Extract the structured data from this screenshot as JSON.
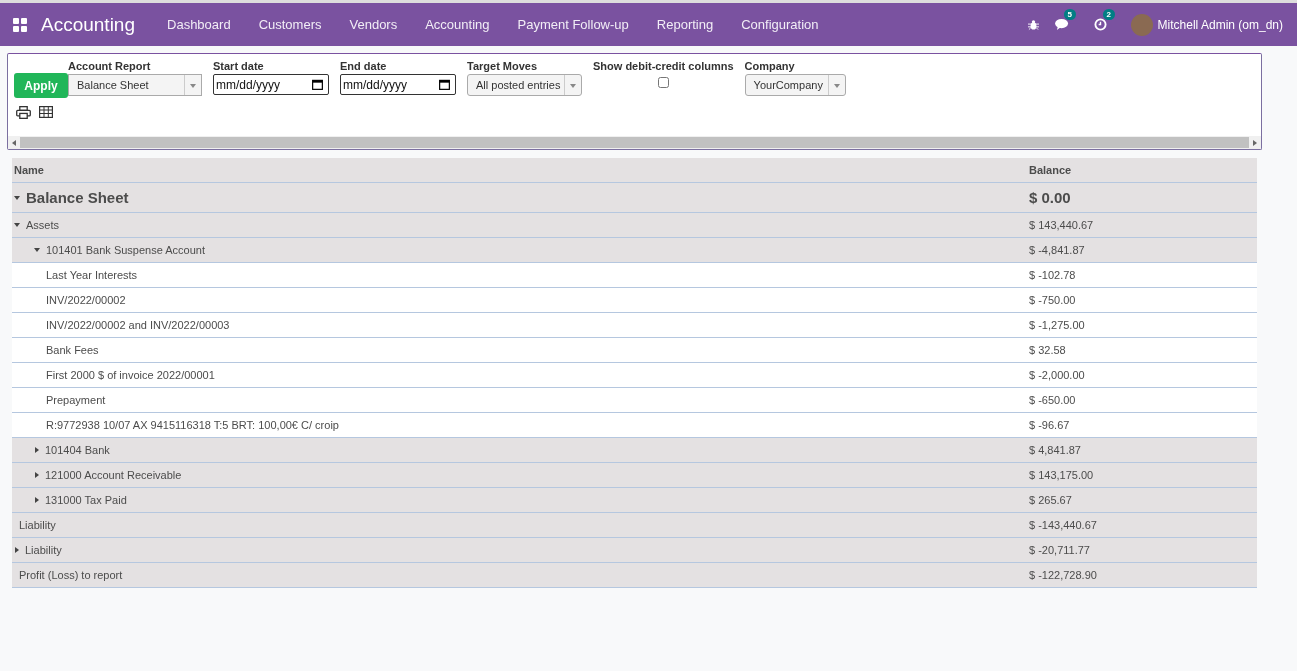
{
  "navbar": {
    "app_title": "Accounting",
    "menu": [
      "Dashboard",
      "Customers",
      "Vendors",
      "Accounting",
      "Payment Follow-up",
      "Reporting",
      "Configuration"
    ],
    "messages_badge": "5",
    "activities_badge": "2",
    "user": "Mitchell Admin (om_dn)"
  },
  "filters": {
    "apply": "Apply",
    "account_report": {
      "label": "Account Report",
      "value": "Balance Sheet"
    },
    "start_date": {
      "label": "Start date",
      "placeholder": "mm/dd/yyyy"
    },
    "end_date": {
      "label": "End date",
      "placeholder": "mm/dd/yyyy"
    },
    "target_moves": {
      "label": "Target Moves",
      "value": "All posted entries"
    },
    "debit_credit": {
      "label": "Show debit-credit columns",
      "checked": false
    },
    "company": {
      "label": "Company",
      "value": "YourCompany"
    }
  },
  "report": {
    "columns": [
      "Name",
      "Balance"
    ],
    "rows": [
      {
        "kind": "title",
        "name": "Balance Sheet",
        "balance": "$ 0.00",
        "expanded": true,
        "children": [
          {
            "kind": "group",
            "name": "Assets",
            "balance": "$ 143,440.67",
            "expanded": true,
            "children": [
              {
                "kind": "group",
                "name": "101401 Bank Suspense Account",
                "balance": "$ -4,841.87",
                "expanded": true,
                "children": [
                  {
                    "kind": "line",
                    "name": "Last Year Interests",
                    "balance": "$ -102.78"
                  },
                  {
                    "kind": "line",
                    "name": "INV/2022/00002",
                    "balance": "$ -750.00"
                  },
                  {
                    "kind": "line",
                    "name": "INV/2022/00002 and INV/2022/00003",
                    "balance": "$ -1,275.00"
                  },
                  {
                    "kind": "line",
                    "name": "Bank Fees",
                    "balance": "$ 32.58"
                  },
                  {
                    "kind": "line",
                    "name": "First 2000 $ of invoice 2022/00001",
                    "balance": "$ -2,000.00"
                  },
                  {
                    "kind": "line",
                    "name": "Prepayment",
                    "balance": "$ -650.00"
                  },
                  {
                    "kind": "line",
                    "name": "R:9772938 10/07 AX 9415116318 T:5 BRT: 100,00€ C/ croip",
                    "balance": "$ -96.67"
                  }
                ]
              },
              {
                "kind": "group",
                "name": "101404 Bank",
                "balance": "$ 4,841.87",
                "expanded": false
              },
              {
                "kind": "group",
                "name": "121000 Account Receivable",
                "balance": "$ 143,175.00",
                "expanded": false
              },
              {
                "kind": "group",
                "name": "131000 Tax Paid",
                "balance": "$ 265.67",
                "expanded": false
              }
            ]
          },
          {
            "kind": "total",
            "name": "Liability",
            "balance": "$ -143,440.67"
          },
          {
            "kind": "group",
            "name": "Liability",
            "balance": "$ -20,711.77",
            "expanded": false
          },
          {
            "kind": "total",
            "name": "Profit (Loss) to report",
            "balance": "$ -122,728.90"
          }
        ]
      }
    ]
  }
}
